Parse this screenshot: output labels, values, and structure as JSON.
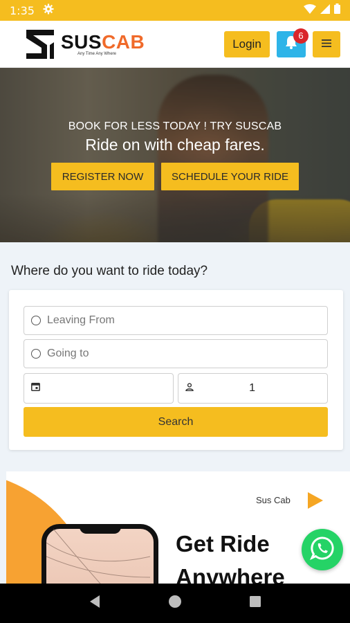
{
  "status_bar": {
    "time": "1:35"
  },
  "header": {
    "logo_sus": "SUS",
    "logo_cab": "CAB",
    "tagline": "Any Time Any Where",
    "login_label": "Login",
    "notification_count": "6",
    "accent": "#f5bd1f",
    "bell_color": "#2eb4e8"
  },
  "hero": {
    "kicker": "BOOK FOR LESS TODAY ! TRY SUSCAB",
    "title": "Ride on with cheap fares.",
    "register_label": "REGISTER NOW",
    "schedule_label": "SCHEDULE YOUR RIDE"
  },
  "search": {
    "question": "Where do you want to ride today?",
    "from_placeholder": "Leaving From",
    "to_placeholder": "Going to",
    "date_value": "",
    "passengers_value": "1",
    "search_label": "Search"
  },
  "promo": {
    "brand": "Sus Cab",
    "heading_line1": "Get Ride",
    "heading_line2": "Anywhere"
  },
  "icons": [
    "settings-icon",
    "wifi-icon",
    "signal-icon",
    "battery-icon",
    "bell-icon",
    "menu-icon",
    "radio-circle-icon",
    "calendar-icon",
    "person-icon",
    "play-icon",
    "whatsapp-icon",
    "back-icon",
    "home-icon",
    "recents-icon"
  ]
}
